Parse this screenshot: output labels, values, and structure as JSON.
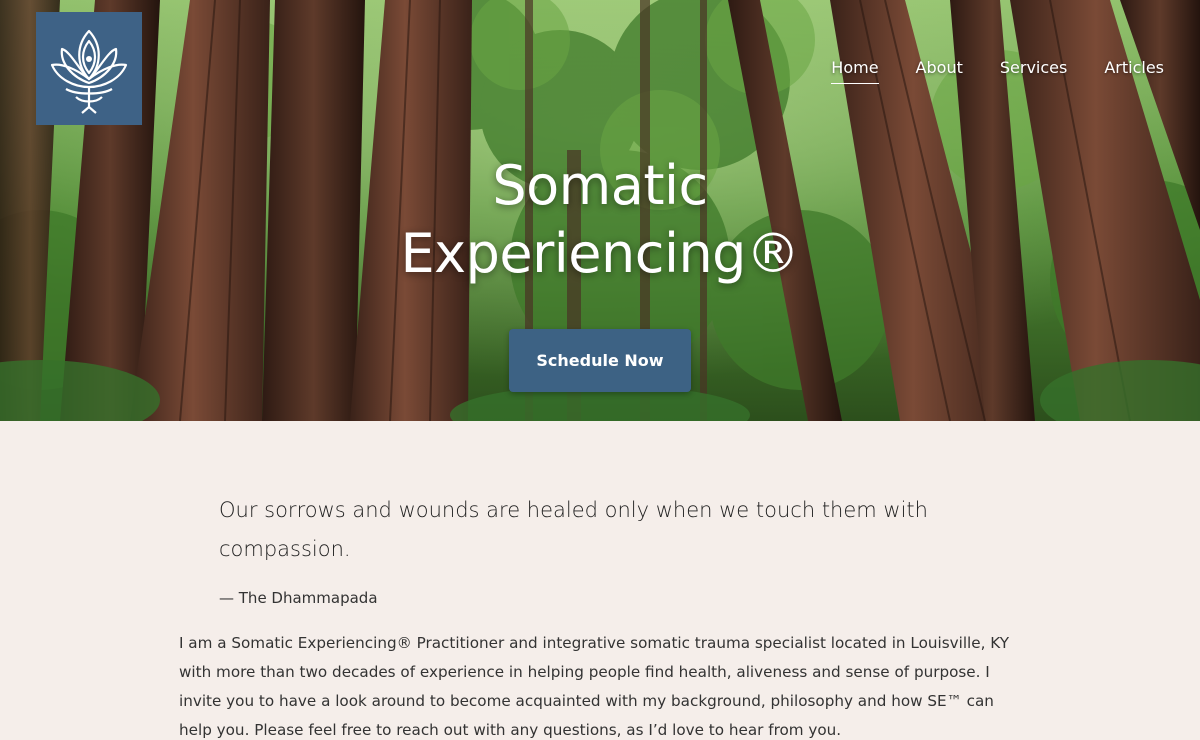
{
  "header": {
    "logo_alt": "lotus logo",
    "nav": [
      {
        "label": "Home",
        "active": true
      },
      {
        "label": "About",
        "active": false
      },
      {
        "label": "Services",
        "active": false
      },
      {
        "label": "Articles",
        "active": false
      }
    ]
  },
  "hero": {
    "title_line1": "Somatic",
    "title_line2": "Experiencing®",
    "cta_label": "Schedule Now",
    "background": "redwood forest photograph"
  },
  "content": {
    "quote": "Our sorrows and wounds are healed only when we touch them with compassion.",
    "attribution": "— The Dhammapada",
    "bio": "I am a Somatic Experiencing® Practitioner and integrative somatic trauma specialist located in Louisville, KY with more than two decades of experience in helping people find health, aliveness and sense of purpose. I invite you to have a look around to become acquainted with my background, philosophy and how SE™ can help you. Please feel free to reach out with any questions, as I’d love to hear from you."
  },
  "colors": {
    "accent": "#3e6286",
    "page_background": "#f5eeea",
    "text": "#333333"
  },
  "icons": {
    "logo": "lotus-icon"
  }
}
